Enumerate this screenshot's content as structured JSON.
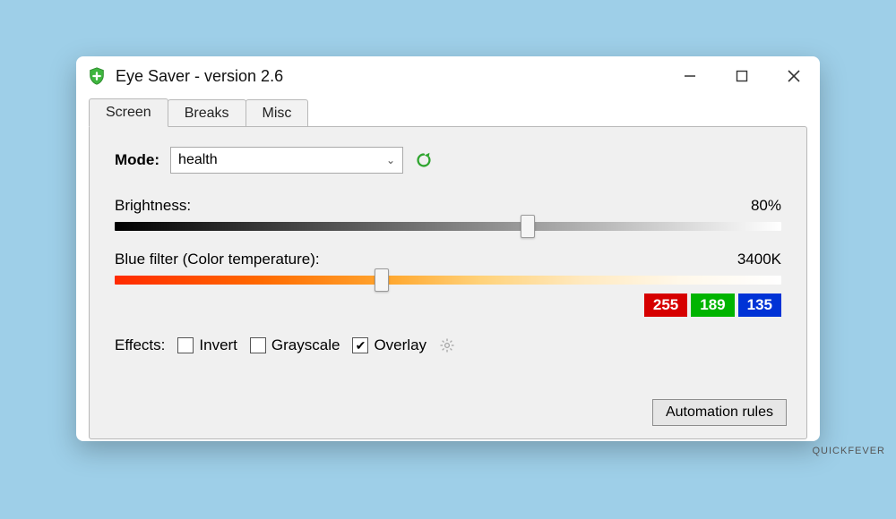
{
  "window": {
    "title": "Eye Saver - version 2.6"
  },
  "tabs": [
    {
      "label": "Screen",
      "active": true
    },
    {
      "label": "Breaks",
      "active": false
    },
    {
      "label": "Misc",
      "active": false
    }
  ],
  "mode": {
    "label": "Mode:",
    "selected": "health"
  },
  "brightness": {
    "label": "Brightness:",
    "value_text": "80%",
    "percent": 62
  },
  "blue_filter": {
    "label": "Blue filter (Color temperature):",
    "value_text": "3400K",
    "percent": 40
  },
  "rgb": {
    "r": "255",
    "g": "189",
    "b": "135"
  },
  "effects": {
    "label": "Effects:",
    "invert": {
      "label": "Invert",
      "checked": false
    },
    "grayscale": {
      "label": "Grayscale",
      "checked": false
    },
    "overlay": {
      "label": "Overlay",
      "checked": true
    }
  },
  "automation_button": "Automation rules",
  "watermark": "QUICKFEVER"
}
